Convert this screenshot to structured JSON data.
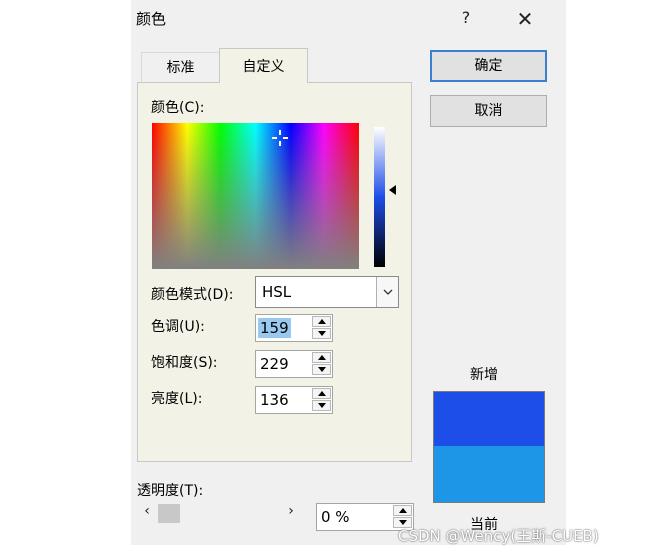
{
  "window": {
    "title": "颜色",
    "help": "?",
    "close": "✕"
  },
  "tabs": [
    {
      "label": "标准",
      "active": false
    },
    {
      "label": "自定义",
      "active": true
    }
  ],
  "buttons": {
    "ok": "确定",
    "cancel": "取消"
  },
  "picker": {
    "colors_label": "颜色(C):",
    "color_model_label": "颜色模式(D):",
    "color_model_value": "HSL",
    "hue_label": "色调(U):",
    "hue_value": "159",
    "saturation_label": "饱和度(S):",
    "saturation_value": "229",
    "luminance_label": "亮度(L):",
    "luminance_value": "136"
  },
  "preview": {
    "new_label": "新增",
    "current_label": "当前",
    "new_color": "#1e4ee8",
    "current_color": "#1e96e8"
  },
  "transparency": {
    "label": "透明度(T):",
    "value": "0 %",
    "left_arrow": "‹",
    "right_arrow": "›"
  },
  "watermark": "CSDN @Wency(王斯-CUEB)"
}
